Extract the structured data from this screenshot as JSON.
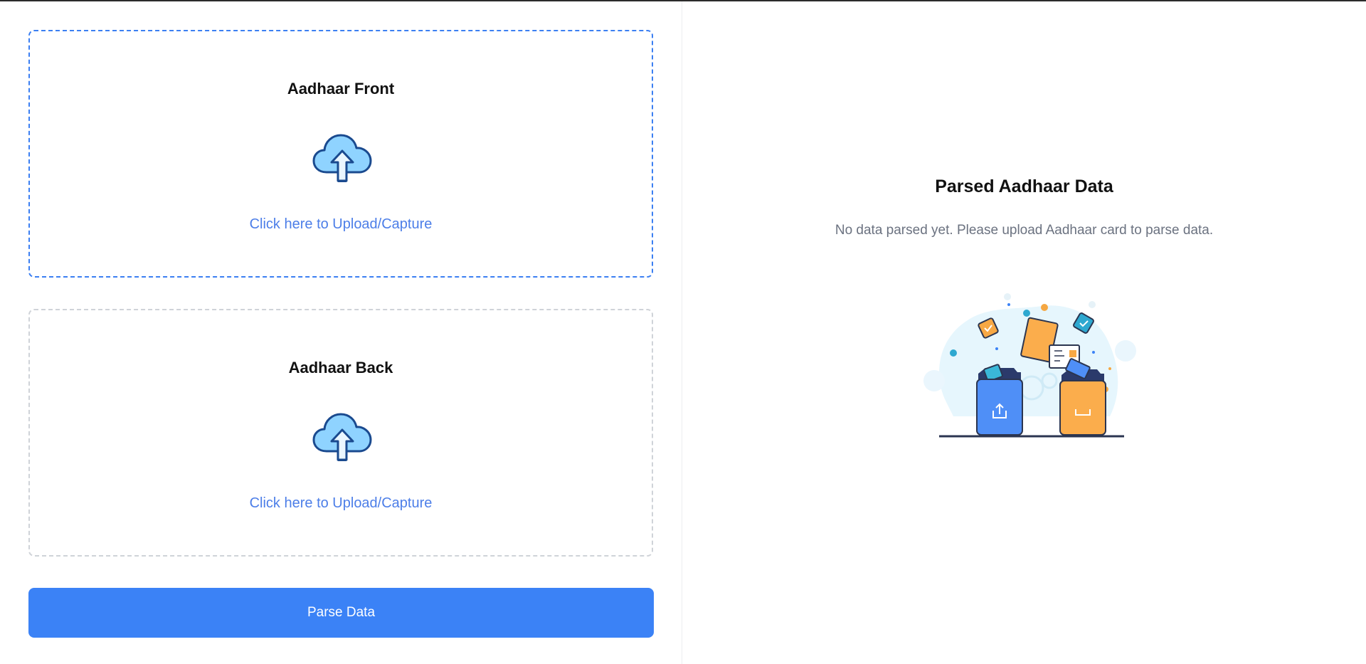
{
  "front_card": {
    "title": "Aadhaar Front",
    "link": "Click here to Upload/Capture",
    "icon": "cloud-upload-icon"
  },
  "back_card": {
    "title": "Aadhaar Back",
    "link": "Click here to Upload/Capture",
    "icon": "cloud-upload-icon"
  },
  "actions": {
    "parse_label": "Parse Data"
  },
  "result": {
    "title": "Parsed Aadhaar Data",
    "empty_message": "No data parsed yet. Please upload Aadhaar card to parse data.",
    "illustration": "empty-folders-illustration"
  },
  "colors": {
    "accent": "#3b82f6",
    "link": "#4c7ee8",
    "active_border": "#3b7ff2",
    "inactive_border": "#cfd3d8",
    "muted_text": "#6b7280"
  }
}
